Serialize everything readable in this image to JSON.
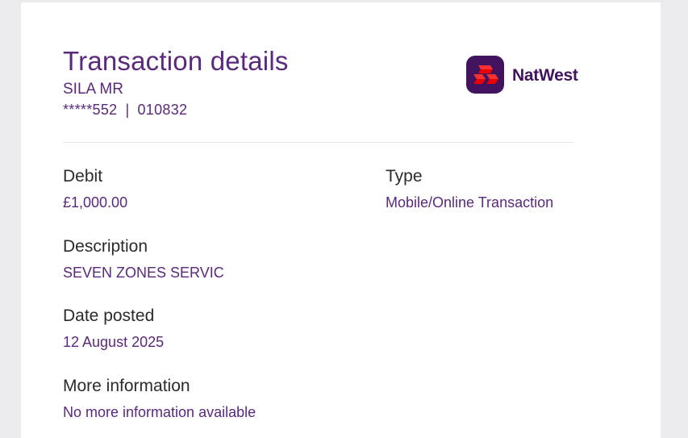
{
  "header": {
    "title": "Transaction details",
    "account_holder": "SILA MR",
    "account_number": "*****552",
    "separator": "|",
    "sort_code": "010832"
  },
  "brand": {
    "name": "NatWest",
    "logo_icon": "natwest-cubes-icon",
    "colors": {
      "purple_dark": "#42145f",
      "purple": "#5a287d",
      "red": "#e90000"
    }
  },
  "details": {
    "debit": {
      "label": "Debit",
      "value": "£1,000.00"
    },
    "type": {
      "label": "Type",
      "value": "Mobile/Online Transaction"
    },
    "description": {
      "label": "Description",
      "value": "SEVEN ZONES SERVIC"
    },
    "date_posted": {
      "label": "Date posted",
      "value": "12 August 2025"
    },
    "more_info": {
      "label": "More information",
      "value": "No more information available"
    }
  }
}
